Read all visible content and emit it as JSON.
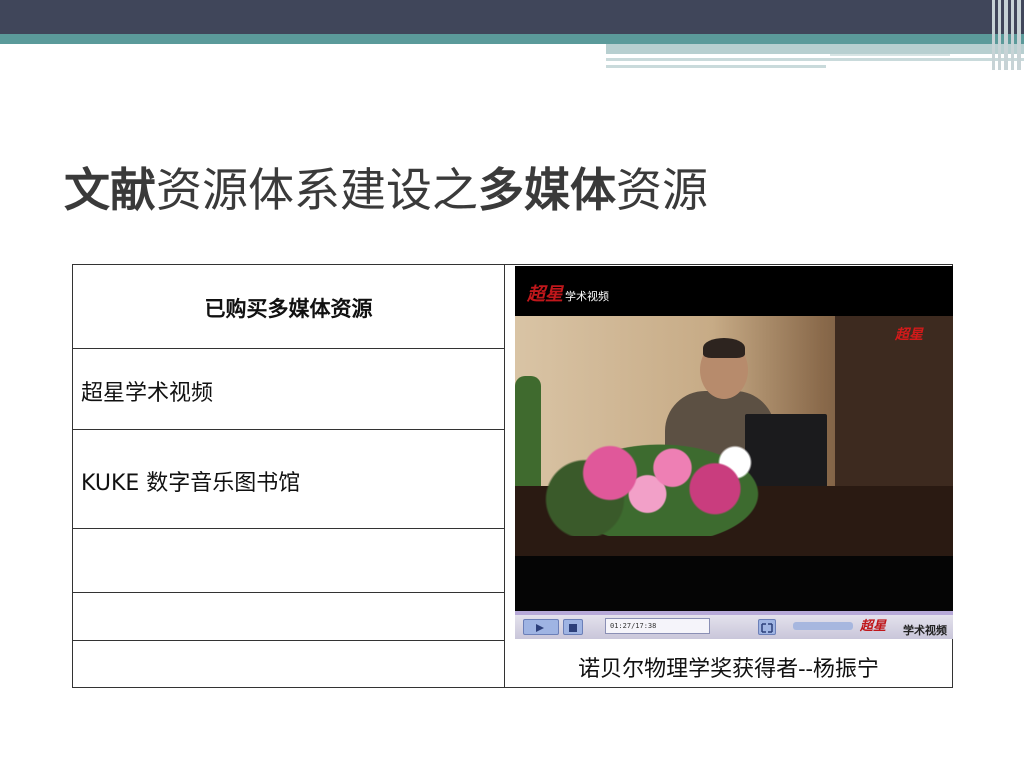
{
  "slide": {
    "title_parts": [
      {
        "text": "文献",
        "bold": true
      },
      {
        "text": "资源体系建设之",
        "bold": false
      },
      {
        "text": "多媒体",
        "bold": true
      },
      {
        "text": "资源",
        "bold": false
      }
    ]
  },
  "table": {
    "header": "已购买多媒体资源",
    "rows": [
      "超星学术视频",
      "KUKE 数字音乐图书馆",
      "",
      "",
      ""
    ],
    "caption": "诺贝尔物理学奖获得者--杨振宁"
  },
  "video": {
    "logo_mark": "超星",
    "logo_text": "学术视频",
    "watermark": "超星",
    "time": "01:27/17:38",
    "brand_mark": "超星",
    "brand_text": "学术视频"
  },
  "colors": {
    "band_dark": "#40465a",
    "band_teal": "#5b9a9a",
    "text": "#3a3a3a"
  }
}
